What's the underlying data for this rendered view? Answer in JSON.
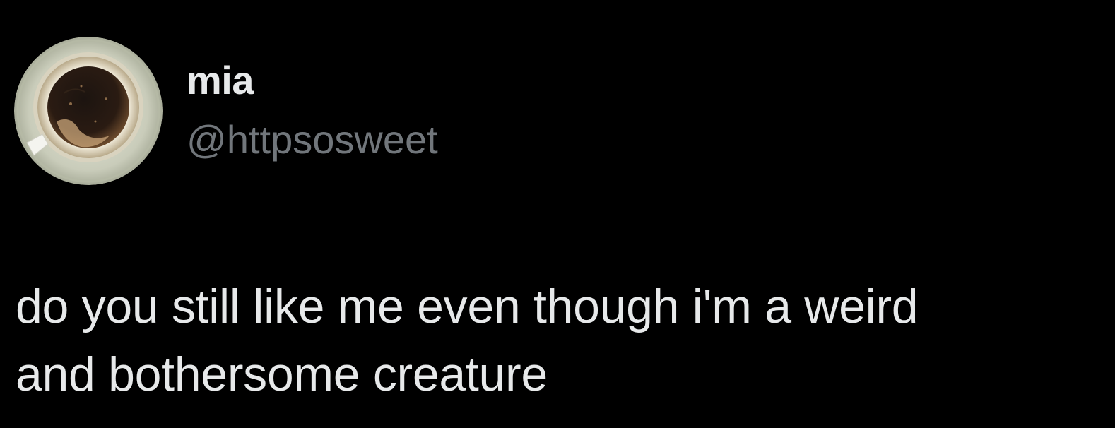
{
  "user": {
    "display_name": "mia",
    "handle": "@httpsosweet",
    "avatar_icon": "coffee-cup-avatar"
  },
  "tweet": {
    "lines": [
      "do you still like me even though i'm a weird",
      "and bothersome creature"
    ]
  },
  "colors": {
    "background": "#000000",
    "name_text": "#e7e9ea",
    "handle_text": "#71767b",
    "body_text": "#e7e9ea"
  }
}
